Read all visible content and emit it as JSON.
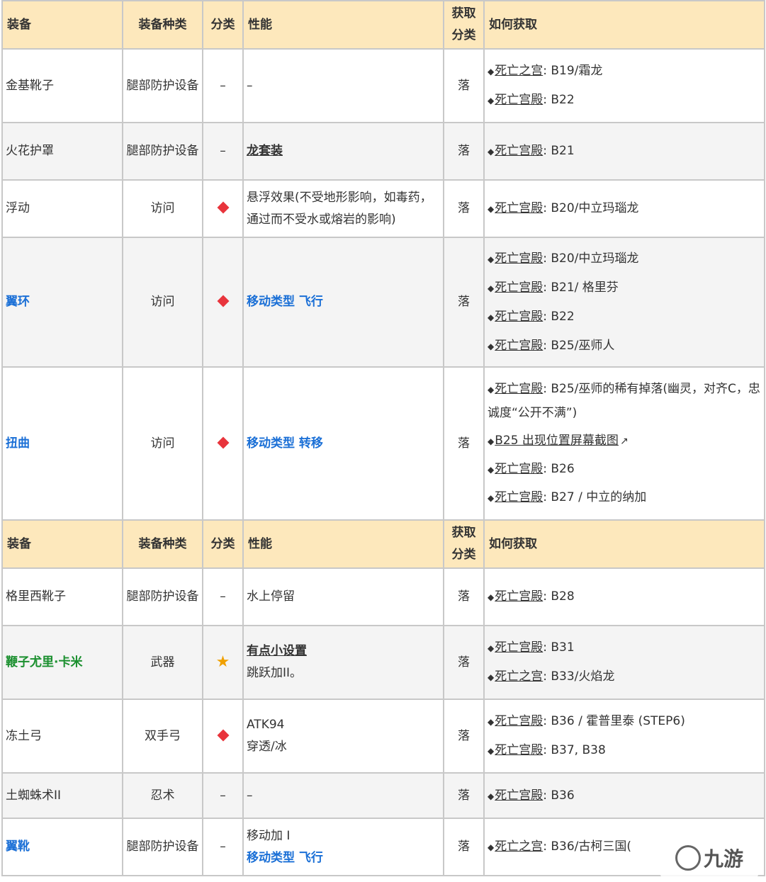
{
  "header": {
    "equip": "装备",
    "kind": "装备种类",
    "cat": "分类",
    "perf": "性能",
    "acq1": "获取",
    "acq2": "分类",
    "how": "如何获取"
  },
  "rows": [
    {
      "name": "金基靴子",
      "kind": "腿部防护设备",
      "cat": "–",
      "perf": "–",
      "acq": "落",
      "src": [
        {
          "b": "◆",
          "l": "死亡之宫",
          "t": ": B19/霜龙"
        },
        {
          "b": "◆",
          "l": "死亡宫殿",
          "t": ": B22"
        }
      ]
    },
    {
      "name": "火花护罩",
      "kind": "腿部防护设备",
      "cat": "–",
      "perf_link": "龙套装",
      "acq": "落",
      "src": [
        {
          "b": "◆",
          "l": "死亡宫殿",
          "t": ": B21"
        }
      ]
    },
    {
      "name": "浮动",
      "kind": "访问",
      "perf": "悬浮效果(不受地形影响，如毒药，通过而不受水或熔岩的影响)",
      "acq": "落",
      "src": [
        {
          "b": "◆",
          "l": "死亡宫殿",
          "t": ": B20/中立玛瑙龙"
        }
      ]
    },
    {
      "name": "翼环",
      "kind": "访问",
      "perf": "移动类型 飞行",
      "acq": "落",
      "src": [
        {
          "b": "◆",
          "l": "死亡宫殿",
          "t": ": B20/中立玛瑙龙"
        },
        {
          "b": "◆",
          "l": "死亡宫殿",
          "t": ": B21/ 格里芬"
        },
        {
          "b": "◆",
          "l": "死亡宫殿",
          "t": ": B22"
        },
        {
          "b": "◆",
          "l": "死亡宫殿",
          "t": ": B25/巫师人"
        }
      ]
    },
    {
      "name": "扭曲",
      "kind": "访问",
      "perf": "移动类型 转移",
      "acq": "落",
      "src": [
        {
          "b": "◆",
          "l": "死亡宫殿",
          "t": ": B25/巫师的稀有掉落(幽灵，对齐C，忠诚度“公开不满”)"
        },
        {
          "b": "◆",
          "l": "B25 出现位置屏幕截图",
          "t": ""
        },
        {
          "b": "◆",
          "l": "死亡宫殿",
          "t": ": B26"
        },
        {
          "b": "◆",
          "l": "死亡宫殿",
          "t": ": B27 / 中立的纳加"
        }
      ]
    },
    {
      "name": "格里西靴子",
      "kind": "腿部防护设备",
      "cat": "–",
      "perf": "水上停留",
      "acq": "落",
      "src": [
        {
          "b": "◆",
          "l": "死亡宫殿",
          "t": ": B28"
        }
      ]
    },
    {
      "name": "鞭子尤里·卡米",
      "kind": "武器",
      "perf_link": "有点小设置",
      "perf2": "跳跃加II。",
      "acq": "落",
      "src": [
        {
          "b": "◆",
          "l": "死亡宫殿",
          "t": ": B31"
        },
        {
          "b": "◆",
          "l": "死亡之宫",
          "t": ": B33/火焰龙"
        }
      ]
    },
    {
      "name": "冻土弓",
      "kind": "双手弓",
      "perf": "ATK94",
      "perf2": "穿透/冰",
      "acq": "落",
      "src": [
        {
          "b": "◆",
          "l": "死亡宫殿",
          "t": ": B36 / 霍普里泰 (STEP6)"
        },
        {
          "b": "◆",
          "l": "死亡宫殿",
          "t": ": B37, B38"
        }
      ]
    },
    {
      "name": "土蜘蛛术II",
      "kind": "忍术",
      "cat": "–",
      "perf": "–",
      "acq": "落",
      "src": [
        {
          "b": "◆",
          "l": "死亡宫殿",
          "t": ": B36"
        }
      ]
    },
    {
      "name": "翼靴",
      "kind": "腿部防护设备",
      "cat": "–",
      "perf": "移动加 I",
      "perf2": "移动类型 飞行",
      "acq": "落",
      "src": [
        {
          "b": "◆",
          "l": "死亡之宫",
          "t": ": B36/古柯三国("
        }
      ]
    }
  ],
  "watermark": "九游",
  "colors": {
    "header_bg": "#fde8bc",
    "blue": "#1a6fd6",
    "green": "#1a8f2e",
    "diamond": "#e8343c",
    "star": "#f0a000"
  },
  "icons": {
    "rare": "red-diamond-icon",
    "unique": "gold-star-icon",
    "external": "external-link-icon"
  }
}
